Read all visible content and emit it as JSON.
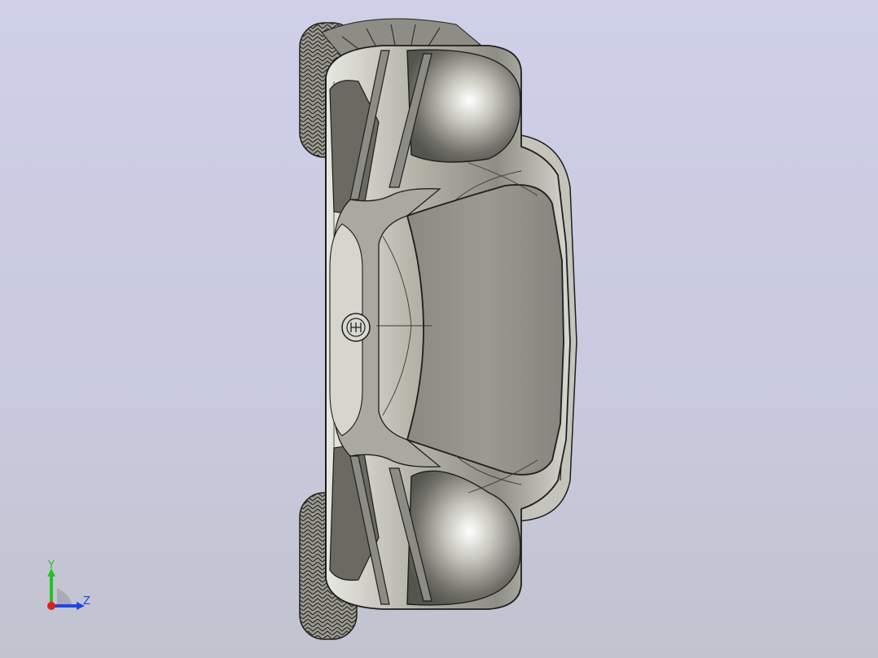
{
  "viewport": {
    "background_top": "#cfd0e8",
    "background_bottom": "#c2c3cf"
  },
  "model": {
    "subject": "car-body-top-view",
    "body_color": "#b9b9ad",
    "shadow_color": "#5e5e58",
    "tire_color": "#3b3b36",
    "edge_color": "#202020"
  },
  "triad": {
    "y_label": "Y",
    "z_label": "Z",
    "y_color": "#22c322",
    "z_color": "#2046e0",
    "x_color": "#e02020"
  }
}
